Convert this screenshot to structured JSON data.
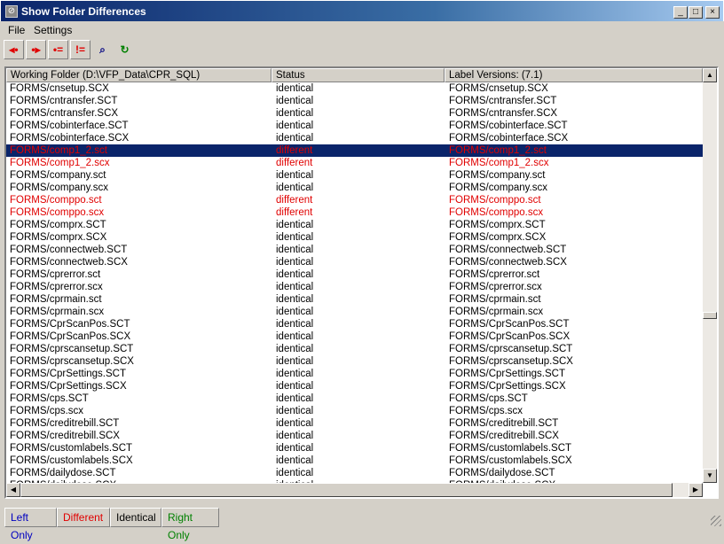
{
  "window": {
    "title": "Show Folder Differences",
    "min": "_",
    "max": "□",
    "close": "×"
  },
  "menu": [
    "File",
    "Settings"
  ],
  "toolbar": [
    {
      "name": "copy-to-left-button",
      "glyph": "◂•",
      "color": "#e00000"
    },
    {
      "name": "copy-to-right-button",
      "glyph": "•▸",
      "color": "#e00000"
    },
    {
      "name": "show-identical-button",
      "glyph": "•=",
      "color": "#e00000"
    },
    {
      "name": "show-different-button",
      "glyph": "!=",
      "color": "#e00000"
    },
    {
      "name": "compare-files-button",
      "glyph": "⌕",
      "color": "#000080"
    },
    {
      "name": "refresh-button",
      "glyph": "↻",
      "color": "#008000"
    }
  ],
  "columns": [
    "Working Folder (D:\\VFP_Data\\CPR_SQL)",
    "Status",
    "Label Versions: (7.1)"
  ],
  "rows": [
    [
      "FORMS/cnsetup.SCX",
      "identical",
      "FORMS/cnsetup.SCX"
    ],
    [
      "FORMS/cntransfer.SCT",
      "identical",
      "FORMS/cntransfer.SCT"
    ],
    [
      "FORMS/cntransfer.SCX",
      "identical",
      "FORMS/cntransfer.SCX"
    ],
    [
      "FORMS/cobinterface.SCT",
      "identical",
      "FORMS/cobinterface.SCT"
    ],
    [
      "FORMS/cobinterface.SCX",
      "identical",
      "FORMS/cobinterface.SCX"
    ],
    [
      "FORMS/comp1_2.sct",
      "different",
      "FORMS/comp1_2.sct"
    ],
    [
      "FORMS/comp1_2.scx",
      "different",
      "FORMS/comp1_2.scx"
    ],
    [
      "FORMS/company.sct",
      "identical",
      "FORMS/company.sct"
    ],
    [
      "FORMS/company.scx",
      "identical",
      "FORMS/company.scx"
    ],
    [
      "FORMS/comppo.sct",
      "different",
      "FORMS/comppo.sct"
    ],
    [
      "FORMS/comppo.scx",
      "different",
      "FORMS/comppo.scx"
    ],
    [
      "FORMS/comprx.SCT",
      "identical",
      "FORMS/comprx.SCT"
    ],
    [
      "FORMS/comprx.SCX",
      "identical",
      "FORMS/comprx.SCX"
    ],
    [
      "FORMS/connectweb.SCT",
      "identical",
      "FORMS/connectweb.SCT"
    ],
    [
      "FORMS/connectweb.SCX",
      "identical",
      "FORMS/connectweb.SCX"
    ],
    [
      "FORMS/cprerror.sct",
      "identical",
      "FORMS/cprerror.sct"
    ],
    [
      "FORMS/cprerror.scx",
      "identical",
      "FORMS/cprerror.scx"
    ],
    [
      "FORMS/cprmain.sct",
      "identical",
      "FORMS/cprmain.sct"
    ],
    [
      "FORMS/cprmain.scx",
      "identical",
      "FORMS/cprmain.scx"
    ],
    [
      "FORMS/CprScanPos.SCT",
      "identical",
      "FORMS/CprScanPos.SCT"
    ],
    [
      "FORMS/CprScanPos.SCX",
      "identical",
      "FORMS/CprScanPos.SCX"
    ],
    [
      "FORMS/cprscansetup.SCT",
      "identical",
      "FORMS/cprscansetup.SCT"
    ],
    [
      "FORMS/cprscansetup.SCX",
      "identical",
      "FORMS/cprscansetup.SCX"
    ],
    [
      "FORMS/CprSettings.SCT",
      "identical",
      "FORMS/CprSettings.SCT"
    ],
    [
      "FORMS/CprSettings.SCX",
      "identical",
      "FORMS/CprSettings.SCX"
    ],
    [
      "FORMS/cps.SCT",
      "identical",
      "FORMS/cps.SCT"
    ],
    [
      "FORMS/cps.scx",
      "identical",
      "FORMS/cps.scx"
    ],
    [
      "FORMS/creditrebill.SCT",
      "identical",
      "FORMS/creditrebill.SCT"
    ],
    [
      "FORMS/creditrebill.SCX",
      "identical",
      "FORMS/creditrebill.SCX"
    ],
    [
      "FORMS/customlabels.SCT",
      "identical",
      "FORMS/customlabels.SCT"
    ],
    [
      "FORMS/customlabels.SCX",
      "identical",
      "FORMS/customlabels.SCX"
    ],
    [
      "FORMS/dailydose.SCT",
      "identical",
      "FORMS/dailydose.SCT"
    ],
    [
      "FORMS/dailydose.SCX",
      "identical",
      "FORMS/dailydose.SCX"
    ]
  ],
  "selected_row": 5,
  "tabs": [
    {
      "label": "Left Only",
      "color": "#0000c0"
    },
    {
      "label": "Different",
      "color": "#e00000"
    },
    {
      "label": "Identical",
      "color": "#000000"
    },
    {
      "label": "Right Only",
      "color": "#008000"
    }
  ]
}
